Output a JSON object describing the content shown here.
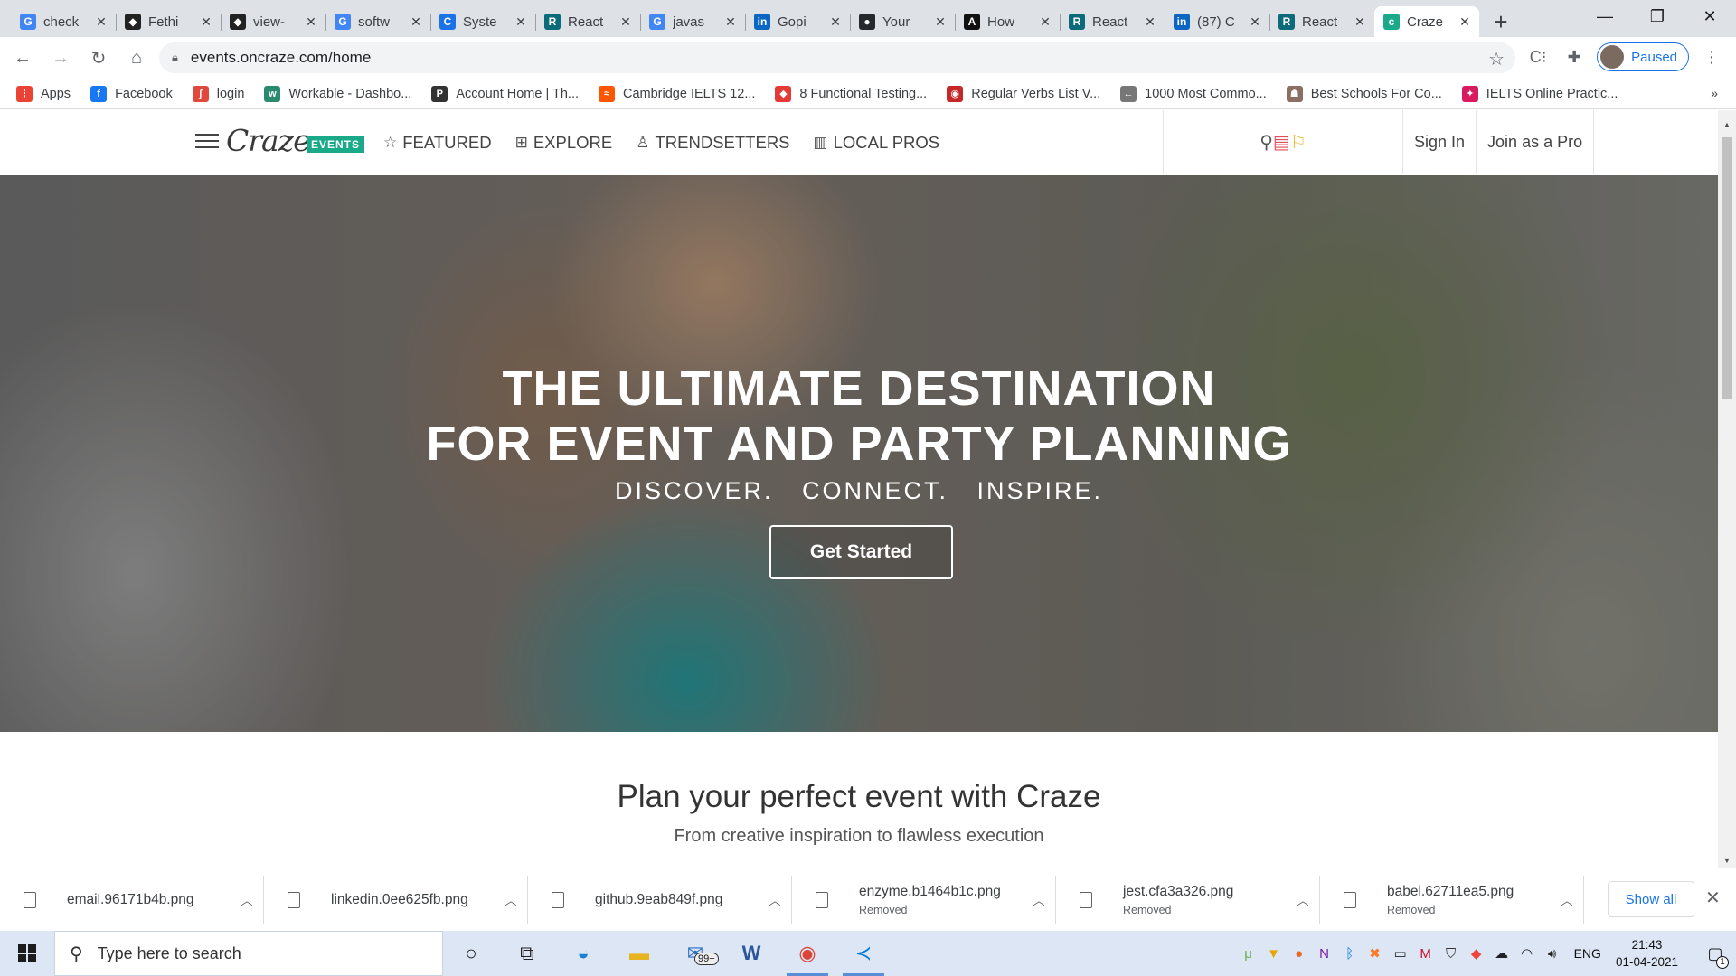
{
  "browser": {
    "tabs": [
      {
        "title": "check",
        "icon": "google",
        "color": "#4285f4",
        "glyph": "G",
        "active": false
      },
      {
        "title": "Fethi",
        "icon": "bag",
        "color": "#222222",
        "glyph": "◆",
        "active": false
      },
      {
        "title": "view-",
        "icon": "bag",
        "color": "#222222",
        "glyph": "◆",
        "active": false
      },
      {
        "title": "softw",
        "icon": "google",
        "color": "#4285f4",
        "glyph": "G",
        "active": false
      },
      {
        "title": "Syste",
        "icon": "c-logo",
        "color": "#1a73e8",
        "glyph": "C",
        "active": false
      },
      {
        "title": "React",
        "icon": "react-box",
        "color": "#0b6b7a",
        "glyph": "R",
        "active": false
      },
      {
        "title": "javas",
        "icon": "google",
        "color": "#4285f4",
        "glyph": "G",
        "active": false
      },
      {
        "title": "Gopi",
        "icon": "linkedin",
        "color": "#0a66c2",
        "glyph": "in",
        "active": false
      },
      {
        "title": "Your",
        "icon": "github",
        "color": "#24292e",
        "glyph": "●",
        "active": false
      },
      {
        "title": "How",
        "icon": "a-logo",
        "color": "#111111",
        "glyph": "A",
        "active": false
      },
      {
        "title": "React",
        "icon": "react-box",
        "color": "#0b6b7a",
        "glyph": "R",
        "active": false
      },
      {
        "title": "(87) C",
        "icon": "linkedin",
        "color": "#0a66c2",
        "glyph": "in",
        "active": false
      },
      {
        "title": "React",
        "icon": "react-box",
        "color": "#0b6b7a",
        "glyph": "R",
        "active": false
      },
      {
        "title": "Craze",
        "icon": "craze",
        "color": "#1aaa8a",
        "glyph": "c",
        "active": true
      }
    ],
    "url": "events.oncraze.com/home",
    "profile_label": "Paused",
    "bookmarks": [
      {
        "label": "Apps",
        "color": "#ea4335",
        "glyph": "⋮"
      },
      {
        "label": "Facebook",
        "color": "#1877f2",
        "glyph": "f"
      },
      {
        "label": "login",
        "color": "#e0483e",
        "glyph": "ʃ"
      },
      {
        "label": "Workable - Dashbo...",
        "color": "#2a8a6f",
        "glyph": "w"
      },
      {
        "label": "Account Home | Th...",
        "color": "#333333",
        "glyph": "P"
      },
      {
        "label": "Cambridge IELTS 12...",
        "color": "#ff5500",
        "glyph": "≈"
      },
      {
        "label": "8 Functional Testing...",
        "color": "#e53935",
        "glyph": "◆"
      },
      {
        "label": "Regular Verbs List V...",
        "color": "#c62828",
        "glyph": "◉"
      },
      {
        "label": "1000 Most Commo...",
        "color": "#777777",
        "glyph": "←"
      },
      {
        "label": "Best Schools For Co...",
        "color": "#8d6e63",
        "glyph": "☗"
      },
      {
        "label": "IELTS Online Practic...",
        "color": "#d81b60",
        "glyph": "✦"
      }
    ]
  },
  "site": {
    "logo_text": "Craze",
    "logo_badge": "EVENTS",
    "nav": [
      {
        "label": "FEATURED",
        "icon": "star-outline-icon",
        "glyph": "☆"
      },
      {
        "label": "EXPLORE",
        "icon": "grid-icon",
        "glyph": "⊞"
      },
      {
        "label": "TRENDSETTERS",
        "icon": "person-icon",
        "glyph": "♙"
      },
      {
        "label": "LOCAL PROS",
        "icon": "building-icon",
        "glyph": "▥"
      }
    ],
    "sign_in": "Sign In",
    "join_pro": "Join as a Pro",
    "hero": {
      "title_line1": "THE ULTIMATE DESTINATION",
      "title_line2": "FOR EVENT AND PARTY PLANNING",
      "subtitle": "DISCOVER.   CONNECT.   INSPIRE.",
      "cta": "Get Started"
    },
    "section": {
      "title": "Plan your perfect event with Craze",
      "subtitle": "From creative inspiration to flawless execution"
    },
    "colors": {
      "brand": "#1aaa8a",
      "ideabook": "#e74c5a",
      "bookmark": "#f0b429"
    }
  },
  "downloads": {
    "items": [
      {
        "name": "email.96171b4b.png",
        "status": ""
      },
      {
        "name": "linkedin.0ee625fb.png",
        "status": ""
      },
      {
        "name": "github.9eab849f.png",
        "status": ""
      },
      {
        "name": "enzyme.b1464b1c.png",
        "status": "Removed"
      },
      {
        "name": "jest.cfa3a326.png",
        "status": "Removed"
      },
      {
        "name": "babel.62711ea5.png",
        "status": "Removed"
      }
    ],
    "show_all": "Show all"
  },
  "taskbar": {
    "search_placeholder": "Type here to search",
    "mail_badge": "99+",
    "language": "ENG",
    "time": "21:43",
    "date": "01-04-2021",
    "notification_count": "1"
  }
}
